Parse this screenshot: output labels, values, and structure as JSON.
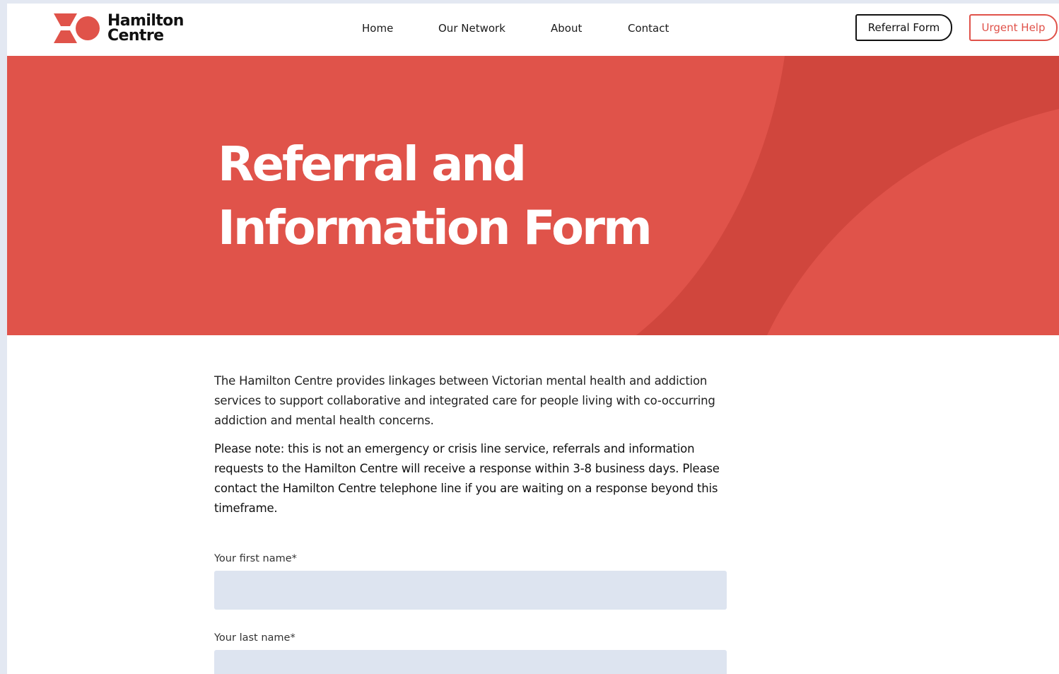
{
  "brand": {
    "name_line1": "Hamilton",
    "name_line2": "Centre",
    "accent_color": "#e0534a",
    "accent_dark": "#d0463d",
    "logo_icon": "hamilton-centre-logo-mark"
  },
  "nav": {
    "items": [
      {
        "label": "Home"
      },
      {
        "label": "Our Network"
      },
      {
        "label": "About"
      },
      {
        "label": "Contact"
      }
    ],
    "referral_button": "Referral Form",
    "urgent_button": "Urgent Help"
  },
  "hero": {
    "title_line1": "Referral and",
    "title_line2": "Information Form"
  },
  "intro": {
    "paragraph": "The Hamilton Centre provides linkages between Victorian mental health and addiction services to support collaborative and integrated care for people living with co-occurring addiction and mental health concerns.",
    "note": "Please note: this is not an emergency or crisis line service, referrals and information requests to the Hamilton Centre will receive a response within 3-8 business days. Please contact the Hamilton Centre telephone line if you are waiting on a response beyond this timeframe."
  },
  "form": {
    "first_name": {
      "label": "Your first name*",
      "value": "",
      "placeholder": ""
    },
    "last_name": {
      "label": "Your last name*",
      "value": "",
      "placeholder": ""
    }
  }
}
